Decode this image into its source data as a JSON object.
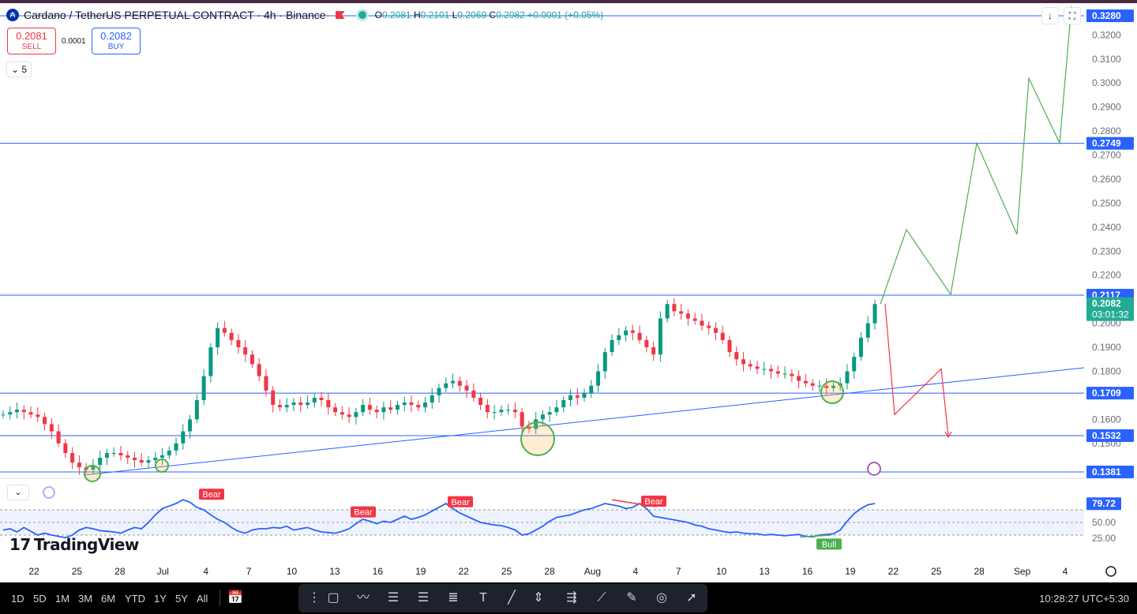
{
  "legend": {
    "symbol": "Cardano / TetherUS PERPETUAL CONTRACT · 4h · Binance",
    "o_label": "O",
    "o": "0.2081",
    "h_label": "H",
    "h": "0.2101",
    "l_label": "L",
    "l": "0.2069",
    "c_label": "C",
    "c": "0.2082",
    "change": "+0.0001 (+0.05%)",
    "logo_glyph": "₳"
  },
  "trade": {
    "sell_price": "0.2081",
    "sell_label": "SELL",
    "spread": "0.0001",
    "buy_price": "0.2082",
    "buy_label": "BUY"
  },
  "indicators_collapsed_count": "5",
  "price_axis": {
    "ticks": [
      "0.3200",
      "0.3100",
      "0.3000",
      "0.2900",
      "0.2800",
      "0.2700",
      "0.2600",
      "0.2500",
      "0.2400",
      "0.2300",
      "0.2200",
      "0.2000",
      "0.1900",
      "0.1800",
      "0.1600",
      "0.1500"
    ],
    "badges": [
      {
        "text": "0.3280",
        "color": "#2962ff"
      },
      {
        "text": "0.2749",
        "color": "#2962ff"
      },
      {
        "text": "0.2117",
        "color": "#2962ff"
      },
      {
        "text": "0.1709",
        "color": "#2962ff"
      },
      {
        "text": "0.1532",
        "color": "#2962ff"
      },
      {
        "text": "0.1381",
        "color": "#2962ff"
      }
    ],
    "current_price": "0.2082",
    "countdown": "03:01:32",
    "current_color": "#22ab94"
  },
  "rsi_axis": {
    "value": "79.72",
    "ticks": [
      "50.00",
      "25.00"
    ]
  },
  "divergence_labels": [
    "Bear",
    "Bear",
    "Bear",
    "Bear",
    "Bull"
  ],
  "time_axis": [
    "22",
    "25",
    "28",
    "Jul",
    "4",
    "7",
    "10",
    "13",
    "16",
    "19",
    "22",
    "25",
    "28",
    "Aug",
    "4",
    "7",
    "10",
    "13",
    "16",
    "19",
    "22",
    "25",
    "28",
    "Sep",
    "4"
  ],
  "brand": "TradingView",
  "bottom_bar": {
    "timeframes": [
      "1D",
      "5D",
      "1M",
      "3M",
      "6M",
      "YTD",
      "1Y",
      "5Y",
      "All"
    ],
    "clock": "10:28:27 UTC+5:30"
  },
  "colors": {
    "up": "#089981",
    "down": "#f23645",
    "line": "#2962ff",
    "rsi": "#2962ff",
    "projection_up": "#4caf50",
    "projection_down": "#f23645"
  },
  "chart_data": {
    "type": "candlestick",
    "price_range": [
      0.136,
      0.332
    ],
    "levels": [
      0.328,
      0.2749,
      0.2117,
      0.1709,
      0.1532,
      0.1381
    ],
    "close_path": [
      0.162,
      0.163,
      0.164,
      0.163,
      0.162,
      0.161,
      0.158,
      0.155,
      0.15,
      0.146,
      0.142,
      0.14,
      0.139,
      0.141,
      0.144,
      0.146,
      0.146,
      0.145,
      0.144,
      0.143,
      0.142,
      0.143,
      0.144,
      0.145,
      0.147,
      0.15,
      0.155,
      0.16,
      0.168,
      0.178,
      0.19,
      0.198,
      0.196,
      0.193,
      0.19,
      0.187,
      0.183,
      0.178,
      0.172,
      0.166,
      0.165,
      0.166,
      0.167,
      0.166,
      0.167,
      0.169,
      0.168,
      0.165,
      0.163,
      0.162,
      0.161,
      0.163,
      0.166,
      0.164,
      0.163,
      0.165,
      0.164,
      0.166,
      0.167,
      0.166,
      0.165,
      0.167,
      0.17,
      0.173,
      0.175,
      0.176,
      0.174,
      0.172,
      0.169,
      0.166,
      0.163,
      0.163,
      0.164,
      0.164,
      0.163,
      0.157,
      0.156,
      0.16,
      0.162,
      0.163,
      0.165,
      0.168,
      0.17,
      0.169,
      0.171,
      0.174,
      0.18,
      0.188,
      0.193,
      0.195,
      0.197,
      0.196,
      0.193,
      0.19,
      0.187,
      0.202,
      0.208,
      0.205,
      0.204,
      0.202,
      0.201,
      0.199,
      0.198,
      0.196,
      0.193,
      0.188,
      0.185,
      0.183,
      0.182,
      0.181,
      0.181,
      0.18,
      0.179,
      0.179,
      0.178,
      0.176,
      0.175,
      0.174,
      0.174,
      0.173,
      0.174,
      0.175,
      0.18,
      0.186,
      0.194,
      0.2,
      0.208
    ],
    "rsi": {
      "range": [
        0,
        100
      ],
      "bands": [
        30,
        70
      ],
      "values": [
        38,
        40,
        35,
        42,
        36,
        30,
        33,
        30,
        28,
        26,
        30,
        38,
        42,
        40,
        37,
        36,
        35,
        33,
        38,
        42,
        40,
        50,
        62,
        72,
        76,
        80,
        86,
        82,
        74,
        70,
        62,
        55,
        50,
        42,
        36,
        33,
        38,
        40,
        40,
        42,
        41,
        44,
        38,
        40,
        42,
        38,
        35,
        34,
        33,
        36,
        40,
        48,
        55,
        52,
        48,
        52,
        50,
        55,
        60,
        55,
        58,
        62,
        68,
        74,
        80,
        72,
        65,
        60,
        55,
        50,
        48,
        46,
        45,
        42,
        38,
        30,
        32,
        38,
        44,
        52,
        58,
        60,
        62,
        66,
        70,
        72,
        76,
        80,
        78,
        76,
        72,
        74,
        80,
        72,
        60,
        58,
        56,
        54,
        52,
        50,
        46,
        44,
        40,
        38,
        36,
        34,
        35,
        33,
        32,
        32,
        30,
        31,
        30,
        29,
        30,
        31,
        28,
        27,
        30,
        31,
        32,
        38,
        52,
        64,
        72,
        78,
        80
      ],
      "labels": [
        {
          "text": "Bear",
          "rsi": 86
        },
        {
          "text": "Bear",
          "rsi": 58
        },
        {
          "text": "Bear",
          "rsi": 74
        },
        {
          "text": "Bear",
          "rsi": 75
        },
        {
          "text": "Bull",
          "rsi": 27
        }
      ]
    },
    "projection_up": [
      [
        0.208,
        0
      ],
      [
        0.239,
        1
      ],
      [
        0.212,
        2
      ],
      [
        0.275,
        3
      ],
      [
        0.237,
        4
      ],
      [
        0.302,
        5
      ],
      [
        0.275,
        6
      ],
      [
        0.332,
        7
      ]
    ],
    "projection_down": [
      [
        0.208,
        0
      ],
      [
        0.162,
        1
      ],
      [
        0.181,
        2
      ],
      [
        0.153,
        3
      ]
    ]
  }
}
